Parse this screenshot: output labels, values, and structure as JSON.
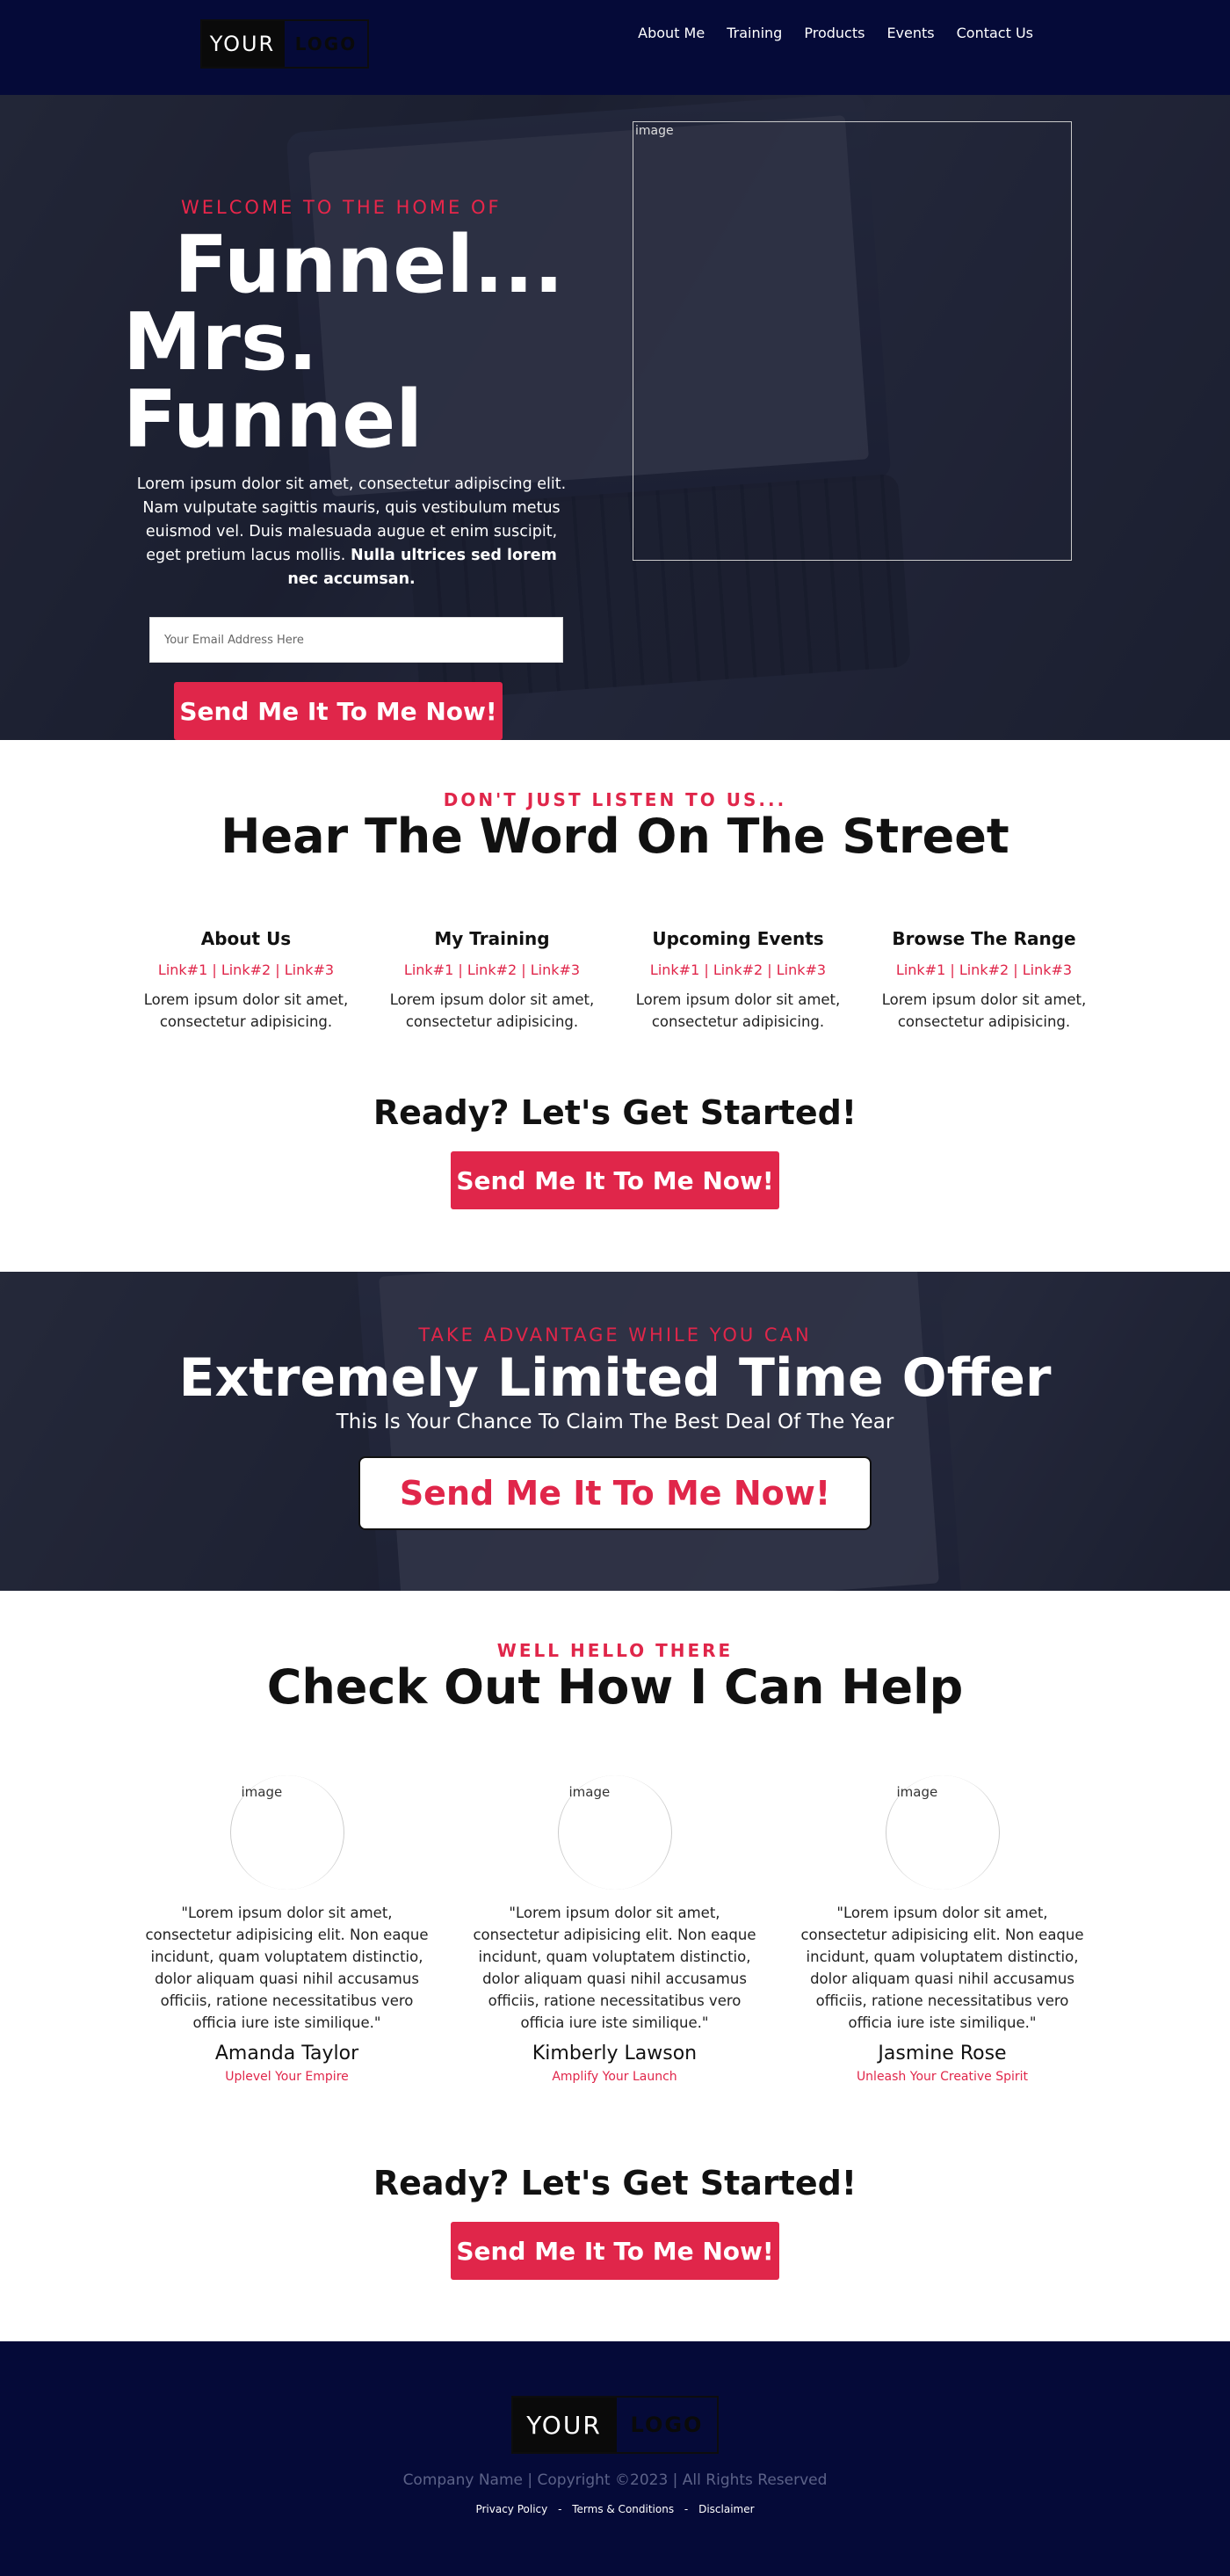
{
  "nav": {
    "logo_left": "YOUR",
    "logo_right": "LOGO",
    "links": [
      "About Me",
      "Training",
      "Products",
      "Events",
      "Contact Us"
    ]
  },
  "hero": {
    "tag": "WELCOME TO THE HOME OF",
    "title_line1": "Funnel...",
    "title_line2": "Mrs.",
    "title_line3": "Funnel",
    "text": "Lorem ipsum dolor sit amet, consectetur adipiscing elit. Nam vulputate sagittis mauris, quis vestibulum metus euismod vel. Duis malesuada augue et enim suscipit, eget pretium lacus mollis. ",
    "text_bold": "Nulla ultrices sed lorem nec accumsan.",
    "email_placeholder": "Your Email Address Here",
    "button": "Send Me It To Me Now!",
    "image_alt": "image"
  },
  "street": {
    "tag": "DON'T JUST LISTEN TO US...",
    "title": "Hear The Word On The Street",
    "columns": [
      {
        "title": "About Us",
        "links": "Link#1 | Link#2 | Link#3",
        "text": "Lorem ipsum dolor sit amet, consectetur adipisicing."
      },
      {
        "title": "My Training",
        "links": "Link#1 | Link#2 | Link#3",
        "text": "Lorem ipsum dolor sit amet, consectetur adipisicing."
      },
      {
        "title": "Upcoming Events",
        "links": "Link#1 | Link#2 | Link#3",
        "text": "Lorem ipsum dolor sit amet, consectetur adipisicing."
      },
      {
        "title": "Browse The Range",
        "links": "Link#1 | Link#2 | Link#3",
        "text": "Lorem ipsum dolor sit amet, consectetur adipisicing."
      }
    ],
    "ready": "Ready? Let's Get Started!",
    "button": "Send Me It To Me Now!"
  },
  "offer": {
    "tag": "TAKE ADVANTAGE WHILE YOU CAN",
    "title": "Extremely Limited Time Offer",
    "subtitle": "This Is Your Chance To Claim The Best Deal Of The Year",
    "button": "Send Me It To Me Now!"
  },
  "help": {
    "tag": "WELL HELLO THERE",
    "title": "Check Out How I Can Help",
    "cards": [
      {
        "image_alt": "image",
        "quote": "\"Lorem ipsum dolor sit amet, consectetur adipisicing elit. Non eaque incidunt, quam voluptatem distinctio, dolor aliquam quasi nihil accusamus officiis, ratione necessitatibus vero officia iure iste similique.\"",
        "name": "Amanda Taylor",
        "role": "Uplevel Your Empire"
      },
      {
        "image_alt": "image",
        "quote": "\"Lorem ipsum dolor sit amet, consectetur adipisicing elit. Non eaque incidunt, quam voluptatem distinctio, dolor aliquam quasi nihil accusamus officiis, ratione necessitatibus vero officia iure iste similique.\"",
        "name": "Kimberly Lawson",
        "role": "Amplify Your Launch"
      },
      {
        "image_alt": "image",
        "quote": "\"Lorem ipsum dolor sit amet, consectetur adipisicing elit. Non eaque incidunt, quam voluptatem distinctio, dolor aliquam quasi nihil accusamus officiis, ratione necessitatibus vero officia iure iste similique.\"",
        "name": "Jasmine Rose",
        "role": "Unleash Your Creative Spirit"
      }
    ],
    "ready": "Ready? Let's Get Started!",
    "button": "Send Me It To Me Now!"
  },
  "footer": {
    "logo_left": "YOUR",
    "logo_right": "LOGO",
    "copyright": "Company Name | Copyright ©2023 | All Rights Reserved",
    "links": [
      "Privacy Policy",
      "Terms & Conditions",
      "Disclaimer"
    ],
    "separator": "-"
  },
  "colors": {
    "navy": "#050a38",
    "accent_red": "#e0264a",
    "white": "#ffffff"
  }
}
